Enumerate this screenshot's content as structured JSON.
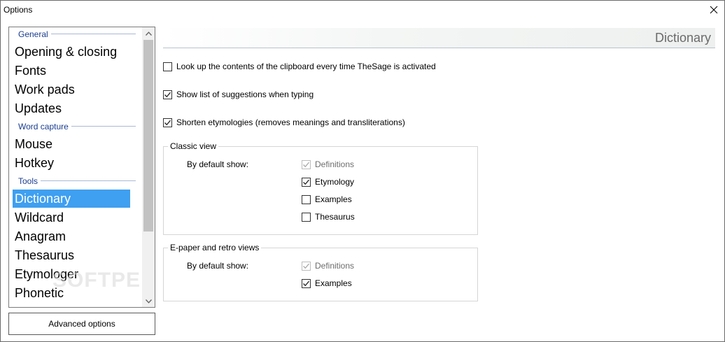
{
  "window": {
    "title": "Options"
  },
  "sidebar": {
    "groups": [
      {
        "header": "General",
        "items": [
          "Opening & closing",
          "Fonts",
          "Work pads",
          "Updates"
        ]
      },
      {
        "header": "Word capture",
        "items": [
          "Mouse",
          "Hotkey"
        ]
      },
      {
        "header": "Tools",
        "items": [
          "Dictionary",
          "Wildcard",
          "Anagram",
          "Thesaurus",
          "Etymologer",
          "Phonetic"
        ]
      }
    ],
    "selected": "Dictionary",
    "watermark": "SOFTPEDIA"
  },
  "advanced_button": "Advanced options",
  "page": {
    "title": "Dictionary",
    "options": [
      {
        "label": "Look up the contents of the clipboard every time TheSage is activated",
        "checked": false
      },
      {
        "label": "Show list of suggestions when typing",
        "checked": true
      },
      {
        "label": "Shorten etymologies (removes meanings and transliterations)",
        "checked": true
      }
    ],
    "classic_view": {
      "title": "Classic view",
      "default_label": "By default show:",
      "items": [
        {
          "label": "Definitions",
          "checked": true,
          "disabled": true
        },
        {
          "label": "Etymology",
          "checked": true,
          "disabled": false
        },
        {
          "label": "Examples",
          "checked": false,
          "disabled": false
        },
        {
          "label": "Thesaurus",
          "checked": false,
          "disabled": false
        }
      ]
    },
    "epaper_view": {
      "title": "E-paper and retro views",
      "default_label": "By default show:",
      "items": [
        {
          "label": "Definitions",
          "checked": true,
          "disabled": true
        },
        {
          "label": "Examples",
          "checked": true,
          "disabled": false
        }
      ]
    }
  },
  "colors": {
    "selection": "#3f9ff0",
    "group_header": "#1a3d8f",
    "disabled_text": "#6d6d6d"
  }
}
